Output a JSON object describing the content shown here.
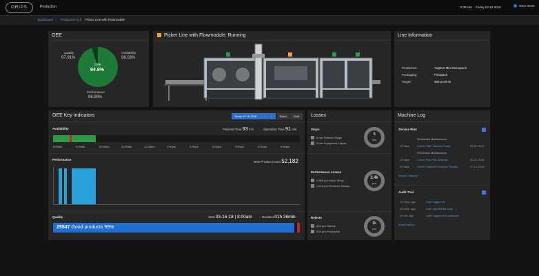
{
  "header": {
    "logo": "ORIPS",
    "app_title": "Production",
    "time": "8:36 AM",
    "date": "Friday 03-16-2018",
    "user": "Sven Greer"
  },
  "breadcrumb": [
    "Dashboard",
    "Production SIT",
    "Picker Line with Flowmodule"
  ],
  "oee": {
    "title": "OEE",
    "quality_label": "Quality",
    "quality_value": "97.91%",
    "availability_label": "Availability",
    "availability_value": "96.03%",
    "center_label": "OEE",
    "center_value": "94.9%",
    "performance_label": "Performance",
    "performance_value": "96.99%",
    "oee_fraction": 0.949
  },
  "machine": {
    "title": "Picker Line with Flowmodule: Running",
    "status_color": "#f0a030"
  },
  "line_info": {
    "title": "Line Information",
    "rows": [
      {
        "label": "Production:",
        "value": "Yoghurt Mini Monopack"
      },
      {
        "label": "Packaging:",
        "value": "Flowpack"
      },
      {
        "label": "Target:",
        "value": "600 pcs/min"
      }
    ]
  },
  "kpi": {
    "title": "OEE Key Indicators",
    "date_button": "Today 03-16-2018",
    "batch_button": "Batch",
    "shift_button": "Shift",
    "availability_title": "Availability",
    "planned_time_label": "Planned Time",
    "planned_time_value": "93",
    "planned_time_unit": "min",
    "operation_time_label": "Operation Time",
    "operation_time_value": "91",
    "operation_time_unit": "min",
    "time_ticks": [
      "8:00am",
      "9:00am",
      "10:00am",
      "11:00am",
      "12:00pm",
      "1:00pm",
      "2:00pm",
      "3:00pm",
      "4:00pm",
      "5:00pm",
      "6:00pm"
    ],
    "performance_title": "Performance",
    "new_product_label": "New Product Count",
    "new_product_value": "52,182",
    "quality_title": "Quality",
    "start_label": "Start",
    "start_value": "03-16-18 | 8:00am",
    "duration_label": "Duration",
    "duration_value": "01h 36min",
    "good_count": "25547",
    "good_text": "Good products 99%",
    "good_fraction": 0.99
  },
  "losses": {
    "title": "Losses",
    "stops_title": "Stops",
    "stops_items": [
      "5 min Planned Stops",
      "3 min Equipment Failure"
    ],
    "stops_ring_value": "3",
    "stops_ring_unit": "min",
    "perf_title": "Performance Losses",
    "perf_items": [
      "1,850 pcs Minor Stops",
      "1,618 pcs Reduced Startup"
    ],
    "perf_ring_value": "3.4k",
    "perf_ring_unit": "pcs",
    "rejects_title": "Rejects",
    "rejects_items": [
      "553 pcs Startup",
      "535 pcs Production"
    ],
    "rejects_ring_value": "1k",
    "rejects_ring_unit": "pcs"
  },
  "log": {
    "title": "Machine Log",
    "service_title": "Service Plan",
    "service_items": [
      {
        "heading": "Scheduled Maintenance",
        "days": "15",
        "link": "Check Filter Vacuum Pump",
        "date": "04-07-2018"
      },
      {
        "heading": "Preventive Maintenance",
        "days": "19",
        "link": "Check Pick Pick Gearbox",
        "date": "04-12-2018"
      },
      {
        "heading": "",
        "days": "26",
        "link": "Check Outfeed Conveyor Section",
        "date": "07-17-2018"
      }
    ],
    "service_history": "Service History ›",
    "audit_title": "Audit Trail",
    "audit_items": [
      {
        "ago": "24 mins. ago",
        "text": "User logged off"
      },
      {
        "ago": "45 mins. ago",
        "text": "User opened flip book"
      },
      {
        "ago": "29 hrs. ago",
        "text": "User logged on to machine"
      }
    ],
    "audit_history": "Audit History ›",
    "days_word": "days",
    "accent": "#3b7de0"
  },
  "colors": {
    "green": "#2e9a48",
    "blue": "#1f6fd0",
    "bar_blue": "#2aa0d8",
    "red": "#c0262b"
  }
}
